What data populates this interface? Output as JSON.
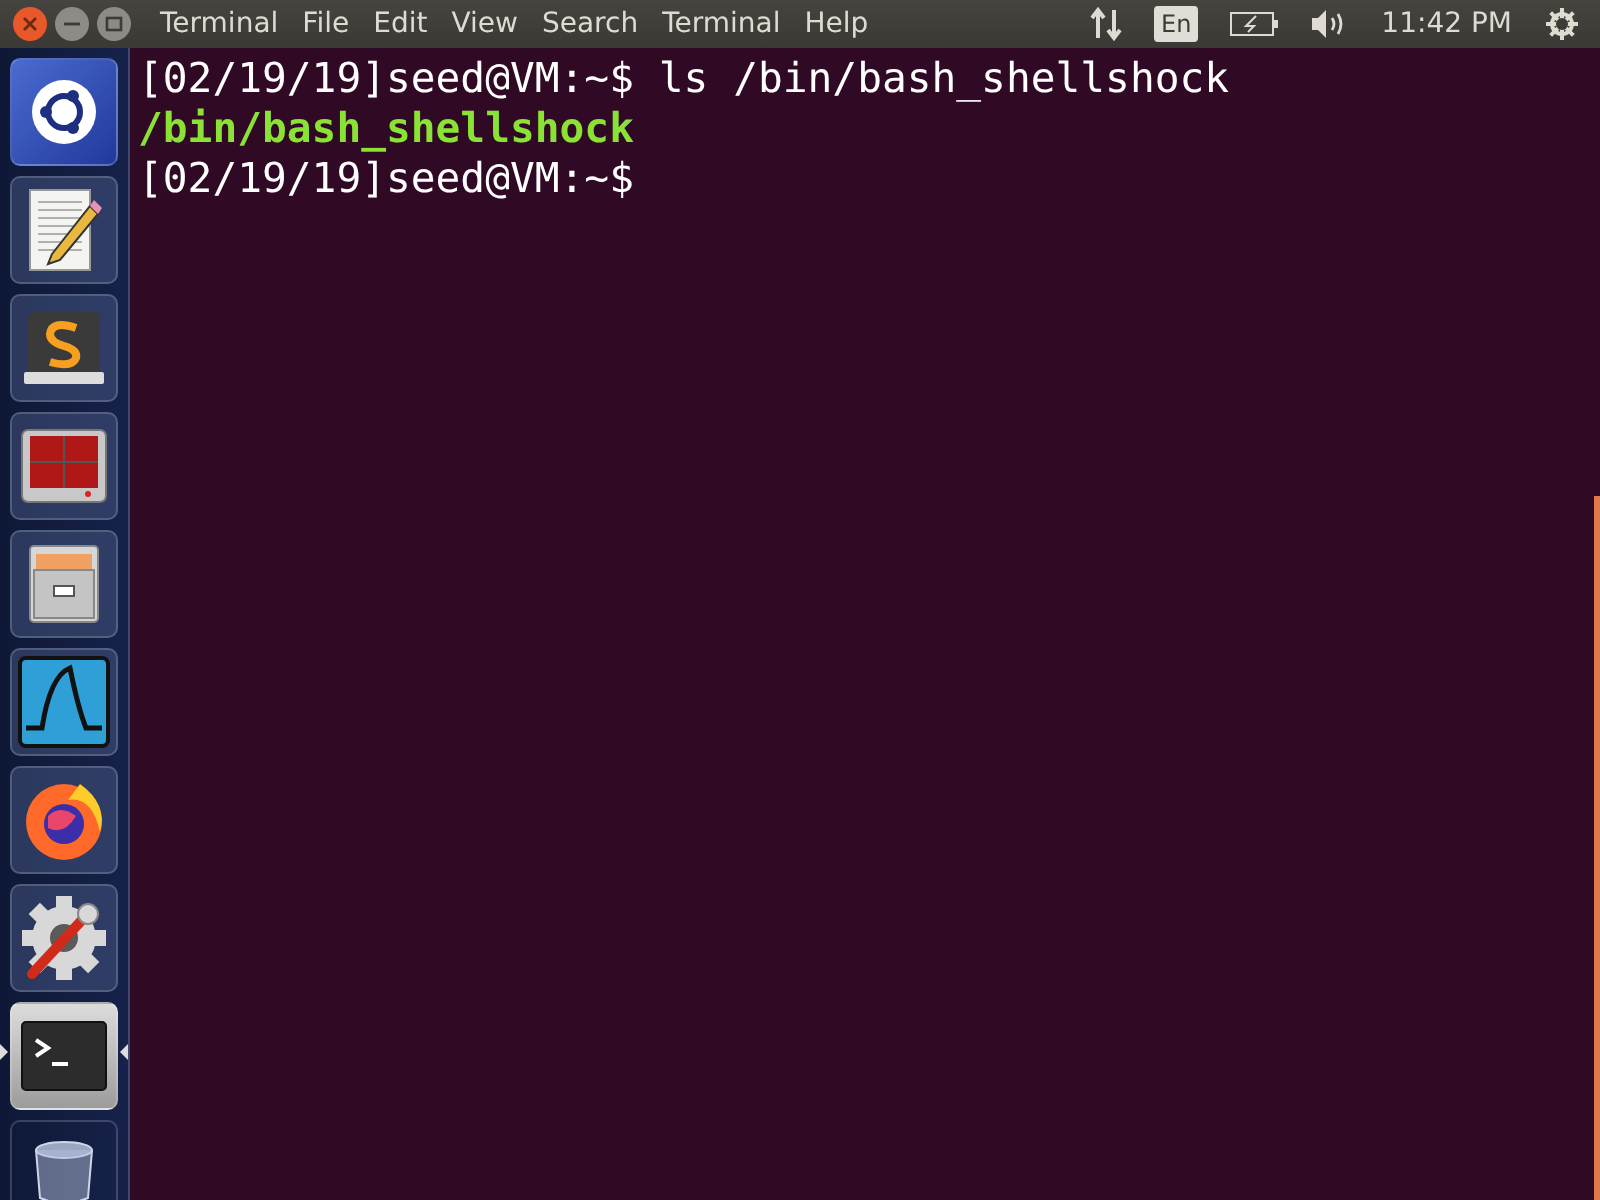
{
  "top_bar": {
    "app_title": "Terminal",
    "menus": [
      "File",
      "Edit",
      "View",
      "Search",
      "Terminal",
      "Help"
    ],
    "keyboard_layout": "En",
    "clock": "11:42 PM"
  },
  "launcher": {
    "items": [
      {
        "kind": "dash",
        "running": false
      },
      {
        "kind": "editor",
        "running": false
      },
      {
        "kind": "sublime",
        "running": false
      },
      {
        "kind": "workspaces",
        "running": false
      },
      {
        "kind": "files",
        "running": false
      },
      {
        "kind": "wireshark",
        "running": false
      },
      {
        "kind": "firefox",
        "running": false
      },
      {
        "kind": "settings",
        "running": false
      },
      {
        "kind": "terminal",
        "running": true
      },
      {
        "kind": "trash",
        "running": false
      }
    ]
  },
  "terminal": {
    "lines": [
      {
        "kind": "prompt",
        "prompt": "[02/19/19]seed@VM:~$",
        "command": "ls /bin/bash_shellshock"
      },
      {
        "kind": "output",
        "text": "/bin/bash_shellshock"
      },
      {
        "kind": "prompt",
        "prompt": "[02/19/19]seed@VM:~$"
      }
    ]
  }
}
